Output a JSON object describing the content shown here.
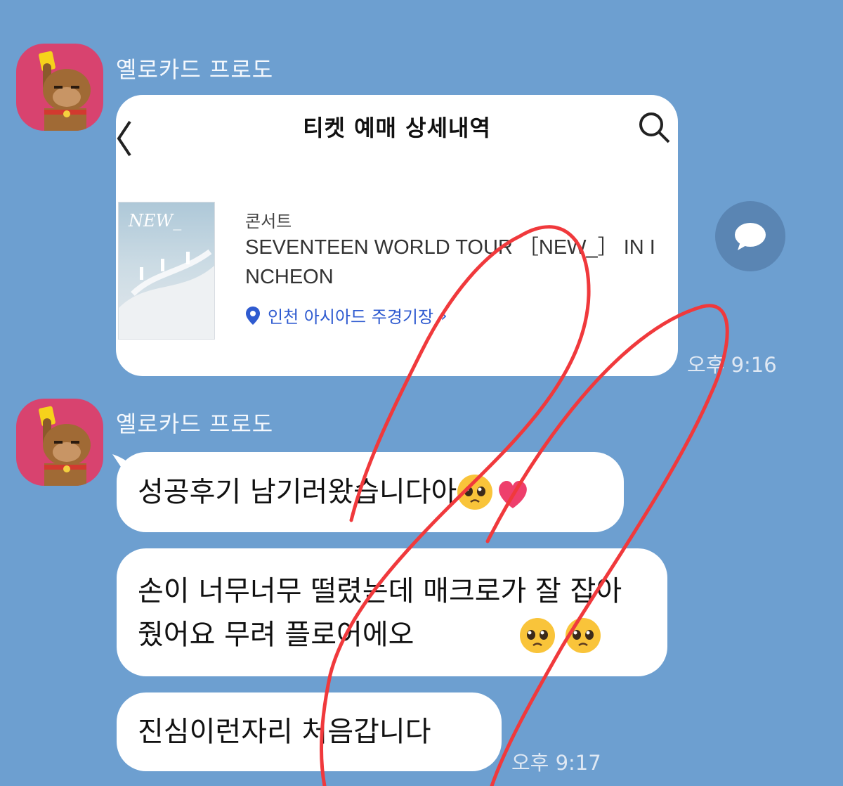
{
  "messages": [
    {
      "sender": "옐로카드 프로도",
      "card": {
        "title": "티켓 예매 상세내역",
        "category": "콘서트",
        "event": "SEVENTEEN WORLD TOUR ［NEW_］ IN INCHEON",
        "venue": "인천 아시아드 주경기장",
        "venue_arrow": "›"
      },
      "time": "오후 9:16"
    },
    {
      "sender": "옐로카드 프로도",
      "bubbles": [
        "성공후기 남기러왔습니다아",
        "손이 너무너무 떨렸는데 매크로가 잘 잡아줬어요 무려 플로어에오",
        "진심이런자리 처음갑니다"
      ],
      "time": "오후 9:17"
    }
  ],
  "colors": {
    "background": "#6d9fd0",
    "avatar": "#d8436f",
    "venue_link": "#2f5bd0",
    "scribble": "#f0393c"
  }
}
